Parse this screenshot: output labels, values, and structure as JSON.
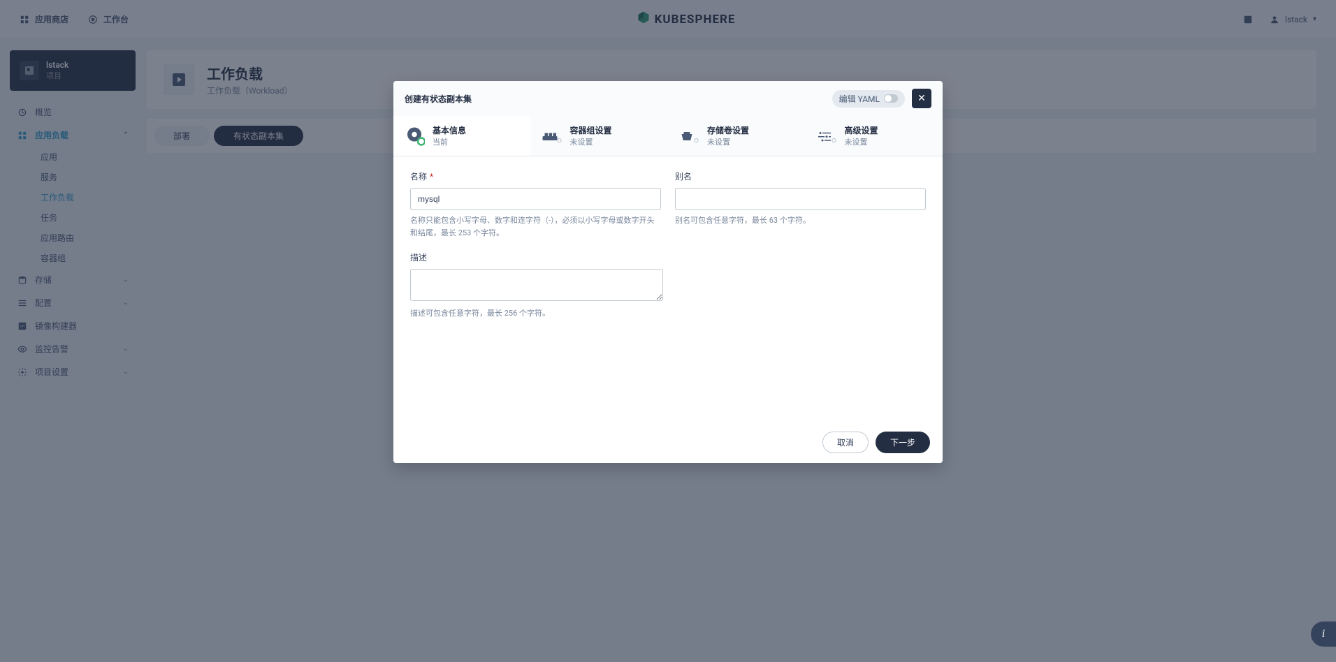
{
  "header": {
    "app_store": "应用商店",
    "workbench": "工作台",
    "product": "KUBESPHERE",
    "user": "lstack"
  },
  "sidebar": {
    "project_name": "lstack",
    "project_sub": "项目",
    "overview": "概览",
    "app_workload": "应用负载",
    "sub_items": {
      "app": "应用",
      "service": "服务",
      "workload": "工作负载",
      "task": "任务",
      "route": "应用路由",
      "podgroup": "容器组"
    },
    "storage": "存储",
    "config": "配置",
    "image_builder": "镜像构建器",
    "monitor": "监控告警",
    "project_settings": "项目设置"
  },
  "page": {
    "title": "工作负载",
    "subtitle": "工作负载（Workload）",
    "tabs": {
      "deploy": "部署",
      "statefulset": "有状态副本集"
    }
  },
  "modal": {
    "title": "创建有状态副本集",
    "yaml_label": "编辑 YAML",
    "steps": {
      "basic": {
        "title": "基本信息",
        "sub": "当前"
      },
      "pod": {
        "title": "容器组设置",
        "sub": "未设置"
      },
      "vol": {
        "title": "存储卷设置",
        "sub": "未设置"
      },
      "adv": {
        "title": "高级设置",
        "sub": "未设置"
      }
    },
    "form": {
      "name_label": "名称",
      "name_value": "mysql",
      "name_hint": "名称只能包含小写字母、数字和连字符（-），必须以小写字母或数字开头和结尾，最长 253 个字符。",
      "alias_label": "别名",
      "alias_value": "",
      "alias_hint": "别名可包含任意字符，最长 63 个字符。",
      "desc_label": "描述",
      "desc_value": "",
      "desc_hint": "描述可包含任意字符，最长 256 个字符。"
    },
    "footer": {
      "cancel": "取消",
      "next": "下一步"
    }
  },
  "help": "i"
}
